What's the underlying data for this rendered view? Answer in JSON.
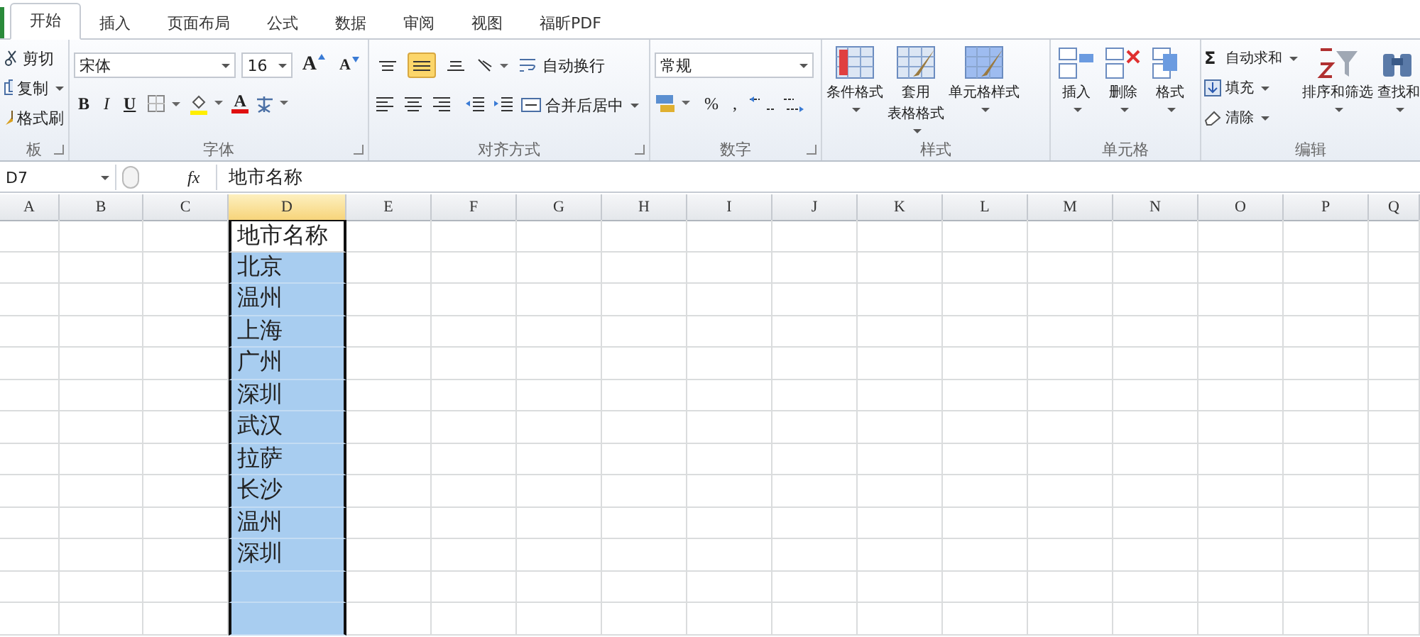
{
  "tabs": [
    {
      "label": "开始",
      "selected": true
    },
    {
      "label": "插入",
      "selected": false
    },
    {
      "label": "页面布局",
      "selected": false
    },
    {
      "label": "公式",
      "selected": false
    },
    {
      "label": "数据",
      "selected": false
    },
    {
      "label": "审阅",
      "selected": false
    },
    {
      "label": "视图",
      "selected": false
    },
    {
      "label": "福昕PDF",
      "selected": false
    }
  ],
  "clipboard": {
    "label": "板",
    "buttons": [
      {
        "kind": "cut",
        "label": "剪切",
        "dropdown": false
      },
      {
        "kind": "copy",
        "label": "复制",
        "dropdown": true
      },
      {
        "kind": "painter",
        "label": "格式刷",
        "dropdown": false
      }
    ]
  },
  "font": {
    "label": "字体",
    "font_name": "宋体",
    "font_size": "16",
    "grow": "A",
    "shrink": "A",
    "styles": [
      "B",
      "I",
      "U"
    ],
    "font_color": "A"
  },
  "alignment": {
    "label": "对齐方式",
    "vertical": [
      {
        "kind": "top",
        "selected": false
      },
      {
        "kind": "middle",
        "selected": true
      },
      {
        "kind": "bottom",
        "selected": false
      }
    ],
    "wrap": "自动换行",
    "merge": "合并后居中"
  },
  "number": {
    "label": "数字",
    "format": "常规",
    "percent": "%",
    "comma": ","
  },
  "styles": {
    "label": "样式",
    "buttons": [
      {
        "kind": "conditional",
        "lines": [
          "条件格式"
        ]
      },
      {
        "kind": "table",
        "lines": [
          "套用",
          "表格格式"
        ]
      },
      {
        "kind": "cellstyle",
        "lines": [
          "单元格样式"
        ]
      }
    ]
  },
  "cells": {
    "label": "单元格",
    "buttons": [
      {
        "kind": "insert",
        "label": "插入"
      },
      {
        "kind": "delete",
        "label": "删除"
      },
      {
        "kind": "format",
        "label": "格式"
      }
    ]
  },
  "editing": {
    "label": "编辑",
    "items": [
      {
        "kind": "sum",
        "icon": "Σ",
        "label": "自动求和"
      },
      {
        "kind": "fill",
        "label": "填充"
      },
      {
        "kind": "clear",
        "label": "清除"
      }
    ],
    "buttons": [
      {
        "kind": "sort",
        "label": "排序和筛选"
      },
      {
        "kind": "find",
        "label": "查找和"
      }
    ]
  },
  "formula_bar": {
    "name_box": "D7",
    "fx": "fx",
    "content": "地市名称"
  },
  "sheet": {
    "columns": [
      {
        "label": "A",
        "selected": false
      },
      {
        "label": "B",
        "selected": false
      },
      {
        "label": "C",
        "selected": false
      },
      {
        "label": "D",
        "selected": true
      },
      {
        "label": "E",
        "selected": false
      },
      {
        "label": "F",
        "selected": false
      },
      {
        "label": "G",
        "selected": false
      },
      {
        "label": "H",
        "selected": false
      },
      {
        "label": "I",
        "selected": false
      },
      {
        "label": "J",
        "selected": false
      },
      {
        "label": "K",
        "selected": false
      },
      {
        "label": "L",
        "selected": false
      },
      {
        "label": "M",
        "selected": false
      },
      {
        "label": "N",
        "selected": false
      },
      {
        "label": "O",
        "selected": false
      },
      {
        "label": "P",
        "selected": false
      },
      {
        "label": "Q",
        "selected": false
      }
    ],
    "column_d_cells": [
      {
        "text": "地市名称",
        "selected": false
      },
      {
        "text": "北京",
        "selected": true
      },
      {
        "text": "温州",
        "selected": true
      },
      {
        "text": "上海",
        "selected": true
      },
      {
        "text": "广州",
        "selected": true
      },
      {
        "text": "深圳",
        "selected": true
      },
      {
        "text": "武汉",
        "selected": true
      },
      {
        "text": "拉萨",
        "selected": true
      },
      {
        "text": "长沙",
        "selected": true
      },
      {
        "text": "温州",
        "selected": true
      },
      {
        "text": "深圳",
        "selected": true
      },
      {
        "selected": true
      },
      {
        "selected": true
      }
    ]
  }
}
